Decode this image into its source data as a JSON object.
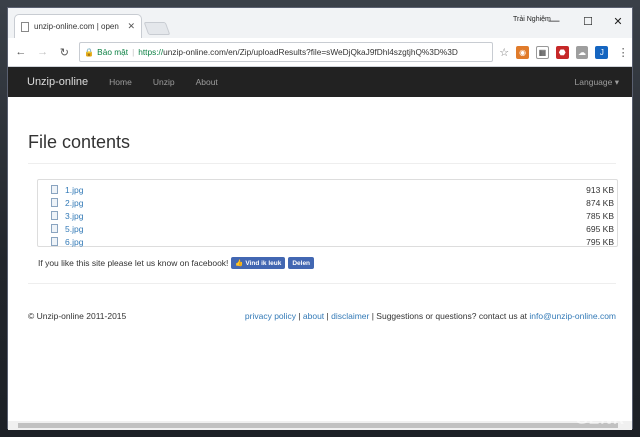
{
  "browser": {
    "tab_title": "unzip-online.com | open",
    "tab_close": "✕",
    "user": "Trải Nghiệm",
    "secure_label": "Bảo mật",
    "url_scheme": "https://",
    "url_rest": "unzip-online.com/en/Zip/uploadResults?file=sWeDjQkaJ9fDhl4szgtjhQ%3D%3D",
    "controls": {
      "minimize": "—",
      "maximize": "☐",
      "close": "✕"
    }
  },
  "site": {
    "brand": "Unzip-online",
    "nav": [
      "Home",
      "Unzip",
      "About"
    ],
    "language": "Language ▾"
  },
  "page": {
    "title": "File contents",
    "files": [
      {
        "name": "1.jpg",
        "size": "913 KB"
      },
      {
        "name": "2.jpg",
        "size": "874 KB"
      },
      {
        "name": "3.jpg",
        "size": "785 KB"
      },
      {
        "name": "5.jpg",
        "size": "695 KB"
      },
      {
        "name": "6.jpg",
        "size": "795 KB"
      }
    ],
    "facebook_text": "If you like this site please let us know on facebook!",
    "fb_like": "👍 Vind ik leuk",
    "fb_share": "Delen"
  },
  "footer": {
    "copyright": "© Unzip-online 2011-2015",
    "privacy": "privacy policy",
    "about": "about",
    "disclaimer": "disclaimer",
    "suggestions": " | Suggestions or questions? contact us at ",
    "email": "info@unzip-online.com",
    "sep": " | "
  },
  "watermark": "GENK",
  "colors": {
    "navbar": "#222222",
    "link": "#337ab7",
    "secure": "#0b8043",
    "facebook": "#4267b2"
  }
}
